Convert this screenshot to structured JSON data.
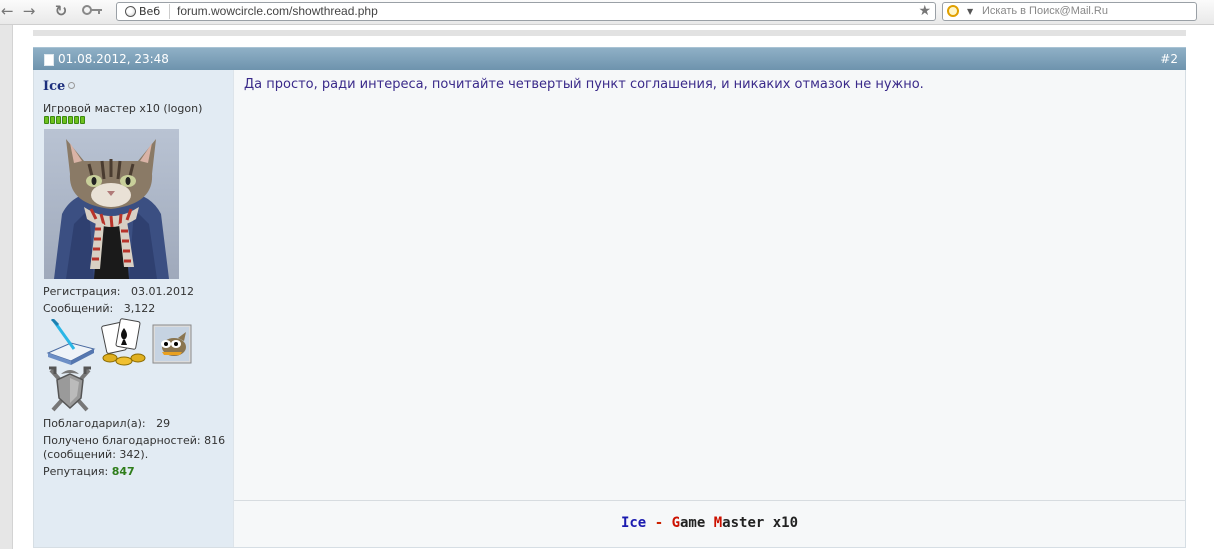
{
  "browser": {
    "web_button_label": "Веб",
    "url": "forum.wowcircle.com/showthread.php",
    "search_placeholder": "Искать в Поиск@Mail.Ru"
  },
  "post": {
    "date": "01.08.2012, 23:48",
    "number": "#2",
    "text": "Да просто, ради интереса, почитайте четвертый пункт соглашения, и никаких отмазок не нужно.",
    "signature": {
      "name": "Ice",
      "dash": "-",
      "g_letter": "G",
      "g_rest": "ame",
      "m_letter": "M",
      "m_rest": "aster x10"
    }
  },
  "user": {
    "name": "Ice",
    "title": "Игровой мастер x10 (logon)",
    "rank_pips": 7,
    "registration_label": "Регистрация:",
    "registration_value": "03.01.2012",
    "posts_label": "Сообщений:",
    "posts_value": "3,122",
    "thanked_label": "Поблагодарил(а):",
    "thanked_value": "29",
    "thanks_received_label": "Получено благодарностей:",
    "thanks_received_value": "816",
    "thanks_posts": "(сообщений: 342).",
    "reputation_label": "Репутация:",
    "reputation_value": "847"
  },
  "colors": {
    "header_bar": "#7ea2ba",
    "user_column": "#e2ebf3",
    "post_text": "#3a2a8a",
    "username": "#1c2e7c",
    "reputation": "#2e7d1a"
  },
  "icons": [
    "back-arrow-icon",
    "forward-arrow-icon",
    "reload-icon",
    "key-icon",
    "globe-icon",
    "bookmark-star-icon",
    "search-magnifier-icon",
    "document-icon",
    "online-status-icon"
  ]
}
